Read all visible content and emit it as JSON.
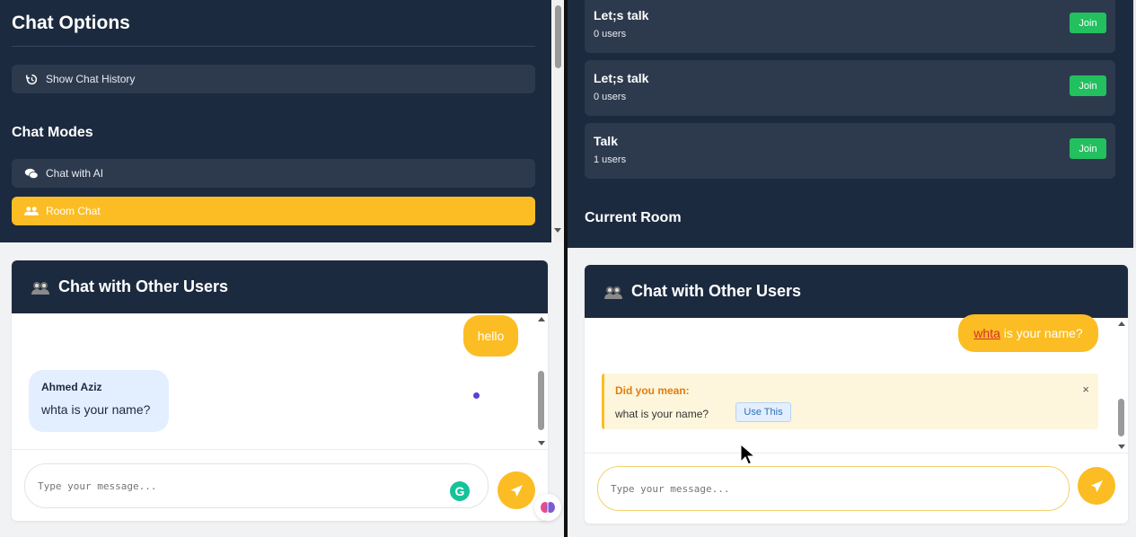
{
  "left": {
    "sidebar": {
      "title": "Chat Options",
      "history_button": "Show Chat History",
      "modes_heading": "Chat Modes",
      "modes": [
        {
          "label": "Chat with AI",
          "icon": "comments-icon",
          "active": false
        },
        {
          "label": "Room Chat",
          "icon": "users-icon",
          "active": true
        }
      ]
    },
    "chat": {
      "header_title": "Chat with Other Users",
      "messages": [
        {
          "own": true,
          "text": "hello"
        },
        {
          "own": false,
          "sender": "Ahmed Aziz",
          "text": "whta is your name?"
        }
      ],
      "input_placeholder": "Type your message..."
    }
  },
  "right": {
    "rooms": [
      {
        "name": "Let;s talk",
        "users": "0 users",
        "join_label": "Join"
      },
      {
        "name": "Let;s talk",
        "users": "0 users",
        "join_label": "Join"
      },
      {
        "name": "Talk",
        "users": "1 users",
        "join_label": "Join"
      }
    ],
    "current_room_heading": "Current Room",
    "chat": {
      "header_title": "Chat with Other Users",
      "own_message_misspelled": "whta",
      "own_message_rest": " is your name?",
      "suggestion": {
        "heading": "Did you mean:",
        "text": "what is your name?",
        "use_label": "Use This",
        "close_symbol": "×"
      },
      "input_placeholder": "Type your message..."
    }
  },
  "colors": {
    "navy": "#1c2a40",
    "card": "#2d3a4e",
    "accent": "#fbbd23",
    "join": "#22c05e",
    "bubble_other": "#e3efff"
  }
}
